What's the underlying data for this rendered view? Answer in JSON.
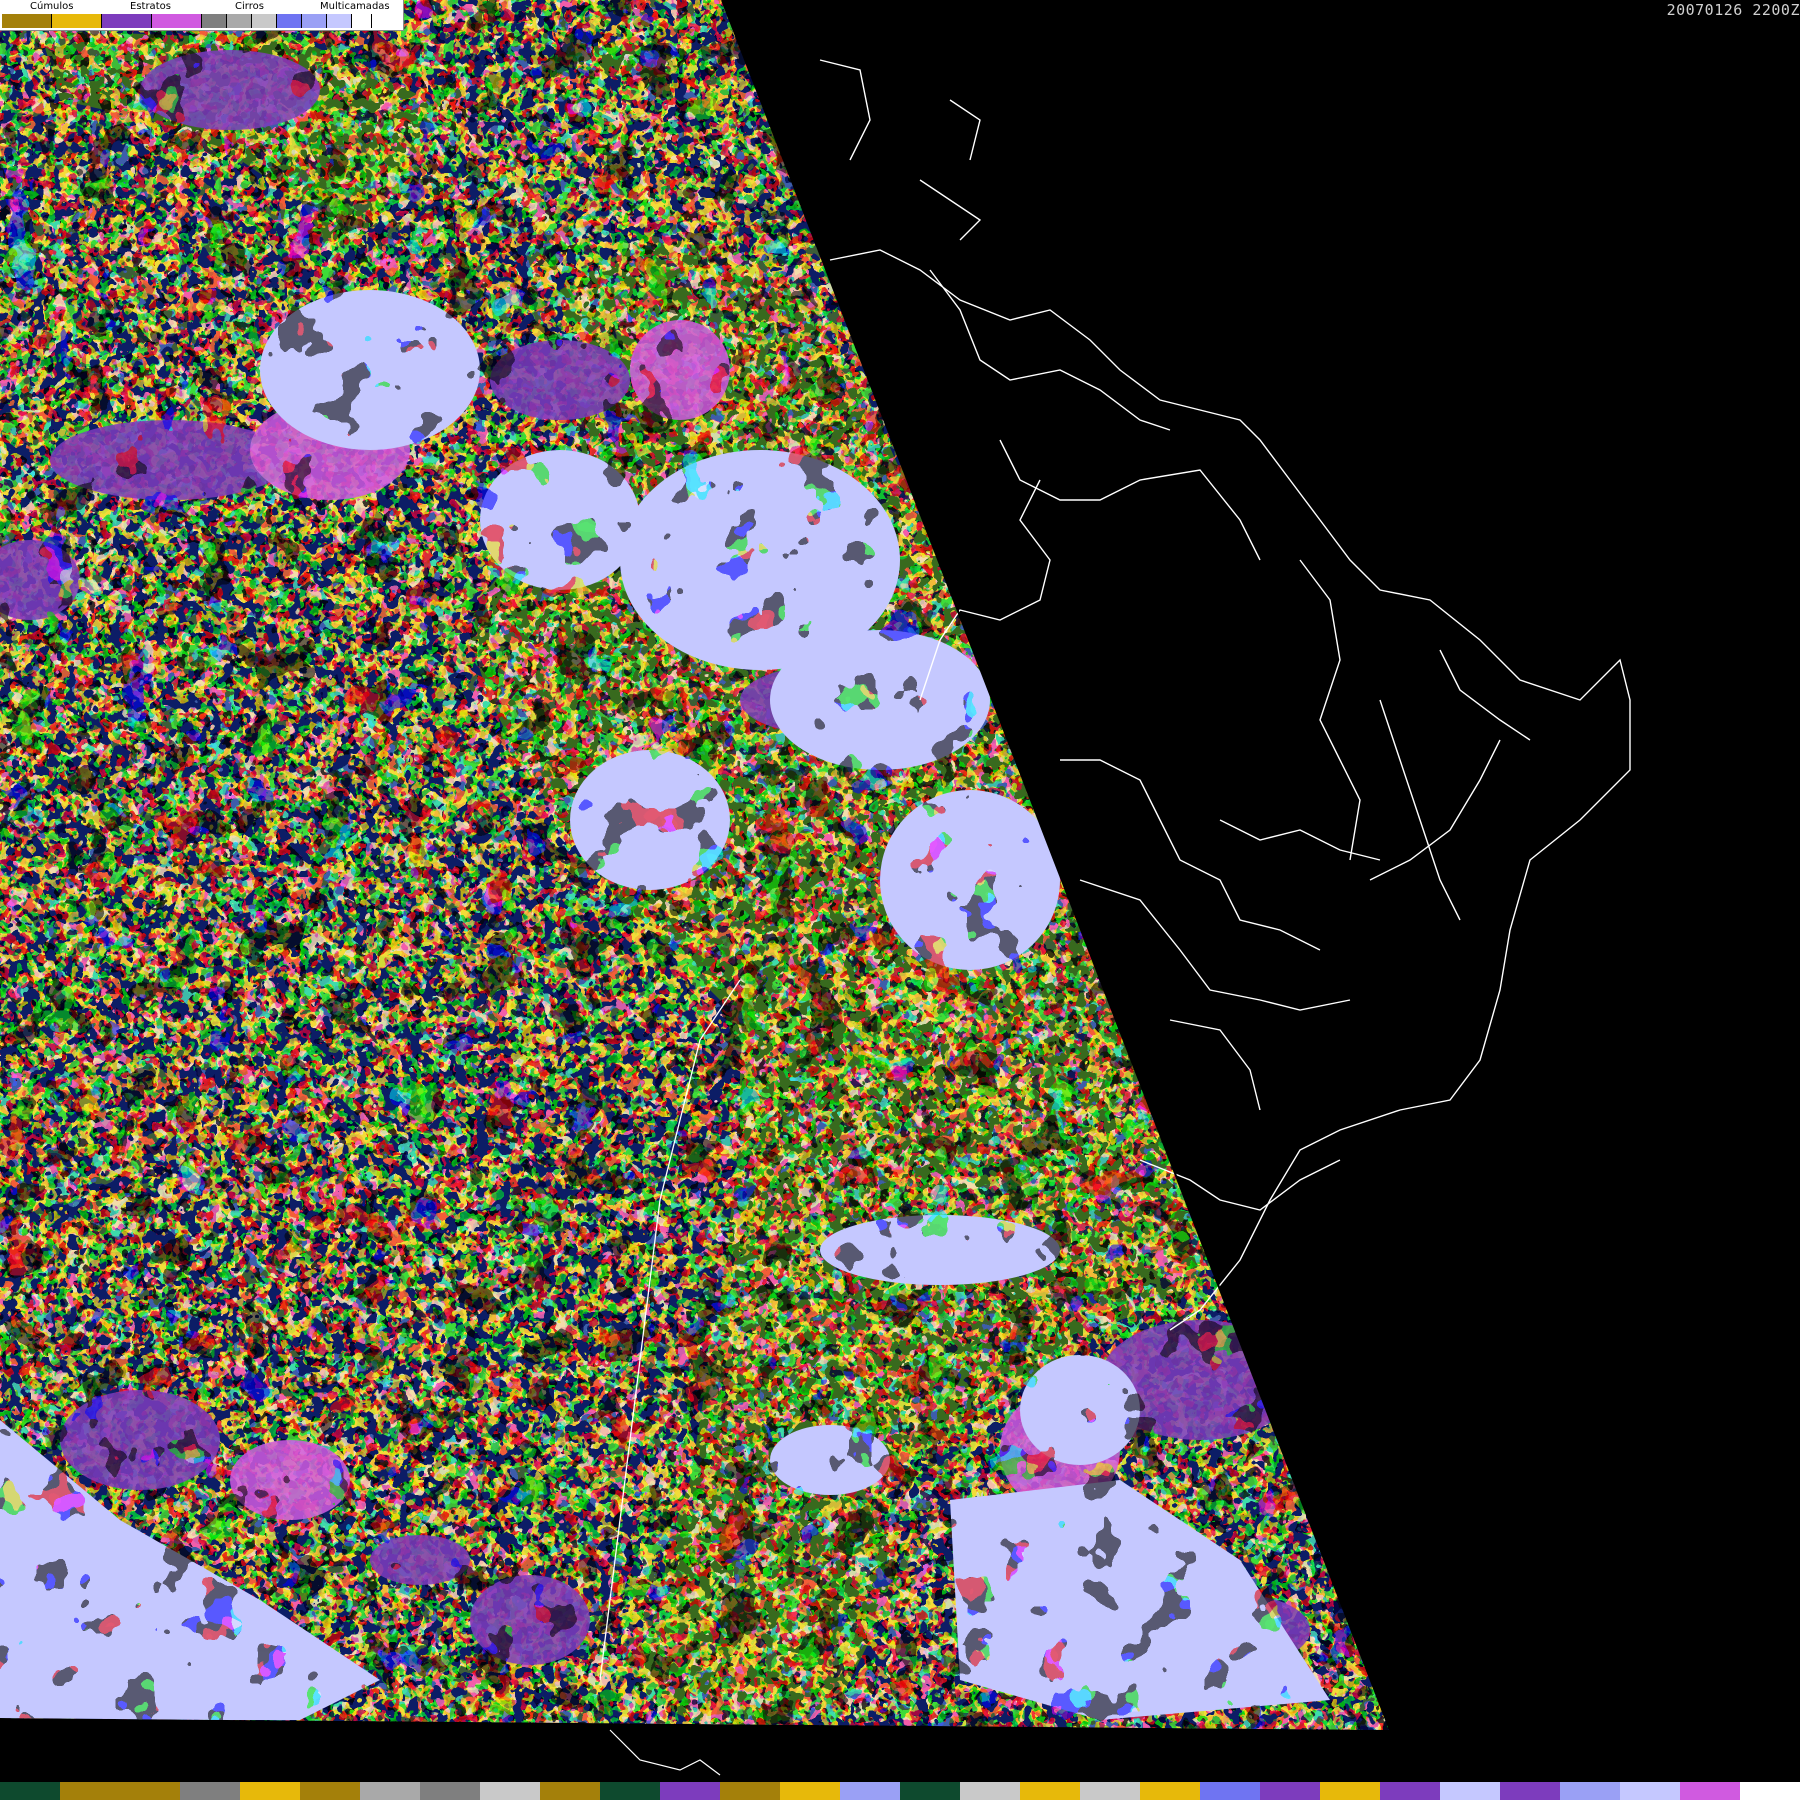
{
  "legend": {
    "labels": [
      "Cúmulos",
      "Estratos",
      "Cirros",
      "Multicamadas"
    ],
    "swatches": [
      "#a4800a",
      "#e7b90a",
      "#7d3cbd",
      "#d05ae0",
      "#7f7f7f",
      "#a9a9a9",
      "#c9c9c9",
      "#6f74f2",
      "#9aa0f5",
      "#c5c8ff",
      "#ffffff"
    ]
  },
  "timestamp": "20070126 2200Z",
  "colors": {
    "ocean": "#0c1d66",
    "land": "#386a1e",
    "cumulus_dark": "#a4800a",
    "cumulus_light": "#e7b90a",
    "stratus_dark": "#7d3cbd",
    "stratus_light": "#d05ae0",
    "cirrus": "#bfbfbf",
    "multilayer": "#c5c8ff",
    "night": "#000000",
    "coastline": "#ffffff"
  },
  "bottom_bar": [
    "#0e4a2e",
    "#a4800a",
    "#a4800a",
    "#7f7f7f",
    "#e7b90a",
    "#a4800a",
    "#a9a9a9",
    "#7f7f7f",
    "#c9c9c9",
    "#a4800a",
    "#0e4a2e",
    "#7d3cbd",
    "#a4800a",
    "#e7b90a",
    "#9aa0f5",
    "#0e4a2e",
    "#c9c9c9",
    "#e7b90a",
    "#c9c9c9",
    "#e7b90a",
    "#6f74f2",
    "#7d3cbd",
    "#e7b90a",
    "#7d3cbd",
    "#c5c8ff",
    "#7d3cbd",
    "#9aa0f5",
    "#c5c8ff",
    "#d05ae0",
    "#ffffff"
  ]
}
